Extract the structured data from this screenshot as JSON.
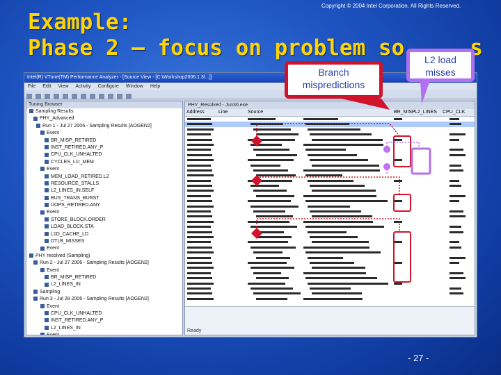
{
  "slide": {
    "copyright": "Copyright © 2004 Intel Corporation. All Rights Reserved.",
    "title_line1": "Example:",
    "title_line2": "Phase 2 – focus on problem so",
    "title_line2_tail": "s",
    "page_number": "- 27 -",
    "title_color": "#ffd400"
  },
  "callouts": {
    "branch_line1": "Branch",
    "branch_line2": "mispredictions",
    "l2_line1": "L2 load",
    "l2_line2": "misses",
    "branch_color": "#d0132a",
    "l2_color": "#b070f0"
  },
  "app_window": {
    "title": "Intel(R) VTune(TM) Performance Analyzer - [Source View - [C:\\Workshop2006.1.3\\...]]",
    "menu": [
      "File",
      "Edit",
      "View",
      "Activity",
      "Configure",
      "Window",
      "Help"
    ],
    "left_panel_title": "Tuning Browser",
    "tree_rows": [
      "Sampling Results",
      "PHY_Advanced",
      "Run 1 - Jul 27 2006 - Sampling Results [AOGEN2]",
      "Event",
      "BR_MISP_RETIRED",
      "INST_RETIRED.ANY_P",
      "CPU_CLK_UNHALTED",
      "CYCLES_L1I_MEM",
      "Event",
      "MEM_LOAD_RETIRED.L2",
      "RESOURCE_STALLS",
      "L2_LINES_IN.SELF",
      "BUS_TRANS_BURST",
      "UOPS_RETIRED.ANY",
      "Event",
      "STORE_BLOCK.ORDER",
      "LOAD_BLOCK.STA",
      "L1D_CACHE_LD",
      "DTLB_MISSES",
      "Event",
      "PHY resolved (Sampling)",
      "Run 2 - Jul 27 2006 - Sampling Results [AOGEN2]",
      "Event",
      "BR_MISP_RETIRED",
      "L2_LINES_IN",
      "Sampling",
      "Run 3 - Jul 28 2006 - Sampling Results [AOGEN2]",
      "Event",
      "CPU_CLK_UNHALTED",
      "INST_RETIRED.ANY_P",
      "L2_LINES_IN",
      "Event"
    ],
    "source_tab": "PHY_Resolved - Jun30.exe",
    "columns": [
      "Address",
      "Line",
      "Source",
      "BR_MISP",
      "L2_LINES",
      "CPU_CLK"
    ],
    "status_left": "Ready"
  }
}
